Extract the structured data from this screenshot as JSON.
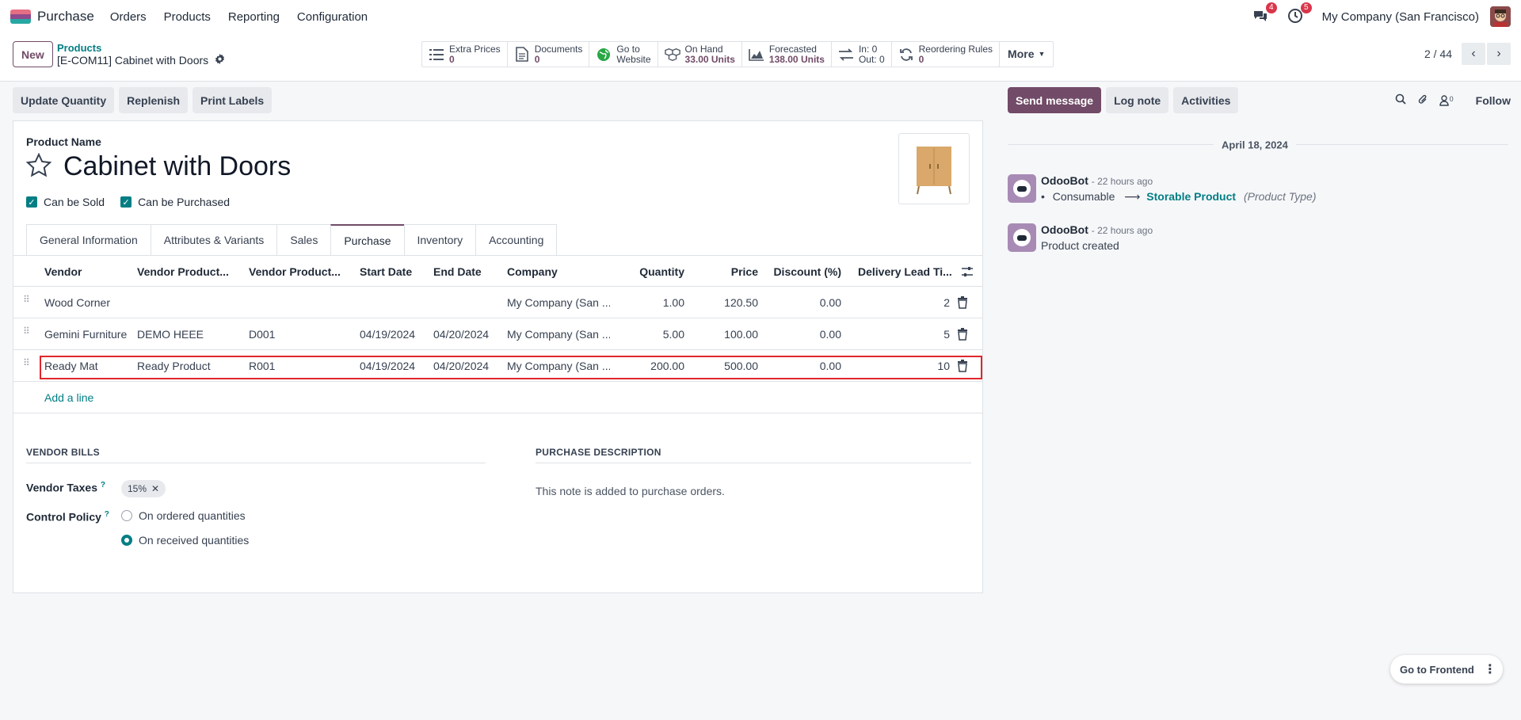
{
  "nav": {
    "app_name": "Purchase",
    "menu": [
      "Orders",
      "Products",
      "Reporting",
      "Configuration"
    ],
    "messages_count": "4",
    "activities_count": "5",
    "company": "My Company (San Francisco)"
  },
  "control": {
    "new_label": "New",
    "breadcrumb_parent": "Products",
    "breadcrumb_current": "[E-COM11] Cabinet with Doors",
    "smart_buttons": [
      {
        "title": "Extra Prices",
        "value": "0"
      },
      {
        "title": "Documents",
        "value": "0"
      },
      {
        "title": "Go to",
        "value": "Website"
      },
      {
        "title": "On Hand",
        "value": "33.00 Units"
      },
      {
        "title": "Forecasted",
        "value": "138.00 Units"
      },
      {
        "title": "In: 0",
        "value": "Out: 0"
      },
      {
        "title": "Reordering Rules",
        "value": "0"
      }
    ],
    "more_label": "More",
    "pager": "2 / 44"
  },
  "statusbar": [
    "Update Quantity",
    "Replenish",
    "Print Labels"
  ],
  "form": {
    "product_name_label": "Product Name",
    "product_name": "Cabinet with Doors",
    "can_be_sold": "Can be Sold",
    "can_be_purchased": "Can be Purchased",
    "tabs": [
      "General Information",
      "Attributes & Variants",
      "Sales",
      "Purchase",
      "Inventory",
      "Accounting"
    ],
    "active_tab": "Purchase"
  },
  "vendors": {
    "columns": [
      "Vendor",
      "Vendor Product...",
      "Vendor Product...",
      "Start Date",
      "End Date",
      "Company",
      "Quantity",
      "Price",
      "Discount (%)",
      "Delivery Lead Ti..."
    ],
    "rows": [
      [
        "Wood Corner",
        "",
        "",
        "",
        "",
        "My Company (San ...",
        "1.00",
        "120.50",
        "0.00",
        "2"
      ],
      [
        "Gemini Furniture",
        "DEMO HEEE",
        "D001",
        "04/19/2024",
        "04/20/2024",
        "My Company (San ...",
        "5.00",
        "100.00",
        "0.00",
        "5"
      ],
      [
        "Ready Mat",
        "Ready Product",
        "R001",
        "04/19/2024",
        "04/20/2024",
        "My Company (San ...",
        "200.00",
        "500.00",
        "0.00",
        "10"
      ]
    ],
    "add_line": "Add a line"
  },
  "bills": {
    "section_title": "VENDOR BILLS",
    "taxes_label": "Vendor Taxes",
    "tax_tag": "15%",
    "control_label": "Control Policy",
    "options": [
      "On ordered quantities",
      "On received quantities"
    ],
    "selected": "On received quantities"
  },
  "purchase_desc": {
    "section_title": "PURCHASE DESCRIPTION",
    "placeholder": "This note is added to purchase orders."
  },
  "chatter": {
    "send_message": "Send message",
    "log_note": "Log note",
    "activities": "Activities",
    "followers_count": "0",
    "follow": "Follow",
    "date": "April 18, 2024",
    "messages": [
      {
        "author": "OdooBot",
        "time": "- 22 hours ago",
        "old": "Consumable",
        "arrow": "⟶",
        "new": "Storable Product",
        "field": "(Product Type)"
      },
      {
        "author": "OdooBot",
        "time": "- 22 hours ago",
        "body": "Product created"
      }
    ]
  },
  "frontend_label": "Go to Frontend",
  "colors": {
    "brand": "#714b67",
    "accent": "#017e84",
    "badge": "#d9364b"
  }
}
